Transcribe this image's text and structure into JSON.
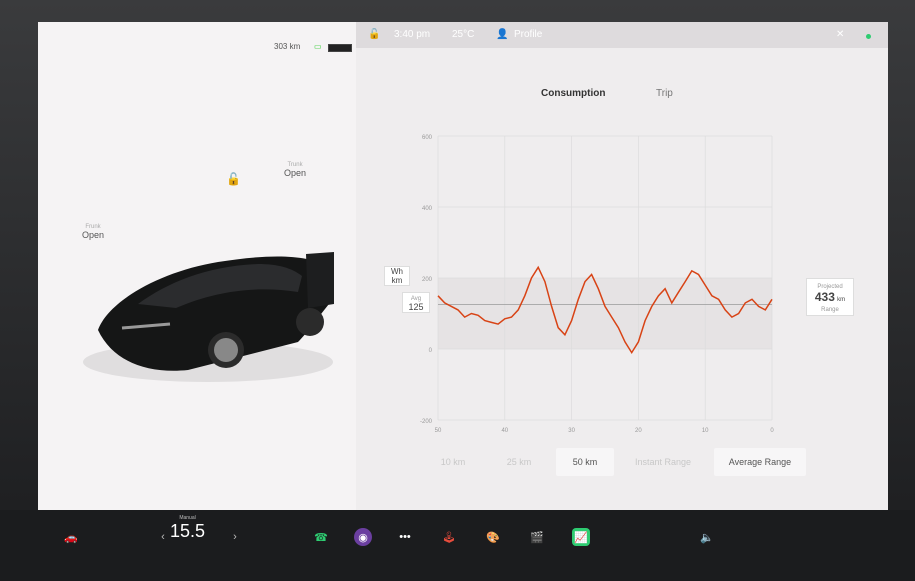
{
  "topbar": {
    "range": "303 km",
    "time": "3:40 pm",
    "temp": "25°C",
    "profile": "Profile"
  },
  "left_panel": {
    "trunk_label": "Trunk",
    "trunk_status": "Open",
    "frunk_label": "Frunk",
    "frunk_status": "Open"
  },
  "energy": {
    "tabs": [
      "Consumption",
      "Trip"
    ],
    "active_tab": 0,
    "y_unit_top": "Wh",
    "y_unit_bottom": "km",
    "avg_label": "Avg",
    "avg_value": "125",
    "projected_label": "Projected",
    "projected_value": "433",
    "projected_unit": "km",
    "range_label": "Range",
    "buttons": [
      "10 km",
      "25 km",
      "50 km",
      "Instant Range",
      "Average Range"
    ],
    "active_buttons": [
      2,
      4
    ]
  },
  "chart_data": {
    "type": "line",
    "x_ticks": [
      50,
      40,
      30,
      20,
      10,
      0
    ],
    "y_ticks": [
      600,
      400,
      200,
      0,
      -200
    ],
    "xlabel": "",
    "ylabel": "Wh/km",
    "avg_line": 125,
    "series": [
      {
        "x": [
          50,
          49,
          48,
          47,
          46,
          45,
          44,
          43,
          42,
          41,
          40,
          39,
          38,
          37,
          36,
          35,
          34,
          33,
          32,
          31,
          30,
          29,
          28,
          27,
          26,
          25,
          24,
          23,
          22,
          21,
          20,
          19,
          18,
          17,
          16,
          15,
          14,
          13,
          12,
          11,
          10,
          9,
          8,
          7,
          6,
          5,
          4,
          3,
          2,
          1,
          0
        ],
        "values": [
          150,
          130,
          120,
          110,
          90,
          100,
          95,
          80,
          75,
          70,
          85,
          90,
          110,
          150,
          200,
          230,
          190,
          120,
          60,
          40,
          80,
          140,
          190,
          210,
          170,
          120,
          90,
          60,
          20,
          -10,
          20,
          80,
          120,
          150,
          170,
          130,
          160,
          190,
          220,
          210,
          180,
          150,
          140,
          110,
          90,
          100,
          130,
          140,
          120,
          110,
          140
        ]
      }
    ]
  },
  "dock": {
    "speed_label": "Manual",
    "speed_value": "15.5",
    "icons": [
      "car-icon",
      "phone-icon",
      "camera-icon",
      "more-icon",
      "joystick-icon",
      "media-icon",
      "theater-icon",
      "energy-icon",
      "volume-icon"
    ]
  }
}
